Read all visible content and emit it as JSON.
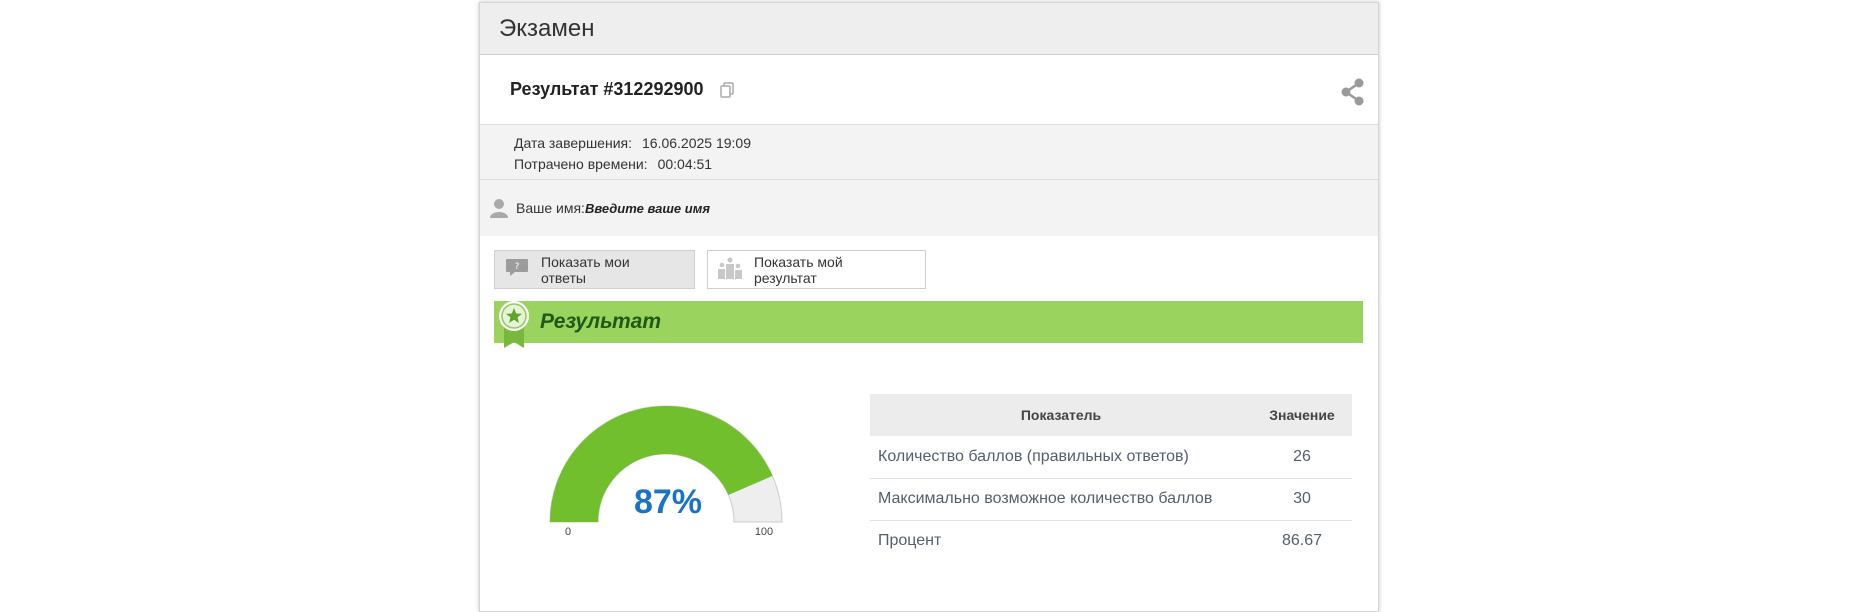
{
  "panel": {
    "title": "Экзамен"
  },
  "result": {
    "id_label": "Результат #312292900"
  },
  "meta": {
    "finished_label": "Дата завершения:",
    "finished_value": "16.06.2025 19:09",
    "time_label": "Потрачено времени:",
    "time_value": "00:04:51"
  },
  "name": {
    "label": "Ваше имя:",
    "value": "Введите ваше имя"
  },
  "buttons": {
    "show_answers": "Показать мои ответы",
    "show_result": "Показать мой результат"
  },
  "banner": {
    "title": "Результат"
  },
  "gauge": {
    "percent": 87,
    "percent_label": "87%",
    "min_label": "0",
    "max_label": "100",
    "fill_color": "#72bf2d",
    "track_color": "#eeeeee",
    "text_color": "#1a73c9"
  },
  "table": {
    "headers": [
      "Показатель",
      "Значение"
    ],
    "rows": [
      [
        "Количество баллов (правильных ответов)",
        "26"
      ],
      [
        "Максимально возможное количество баллов",
        "30"
      ],
      [
        "Процент",
        "86.67"
      ]
    ]
  },
  "colors": {
    "banner_bg": "#9ad45f",
    "banner_text": "#1e5a16"
  }
}
